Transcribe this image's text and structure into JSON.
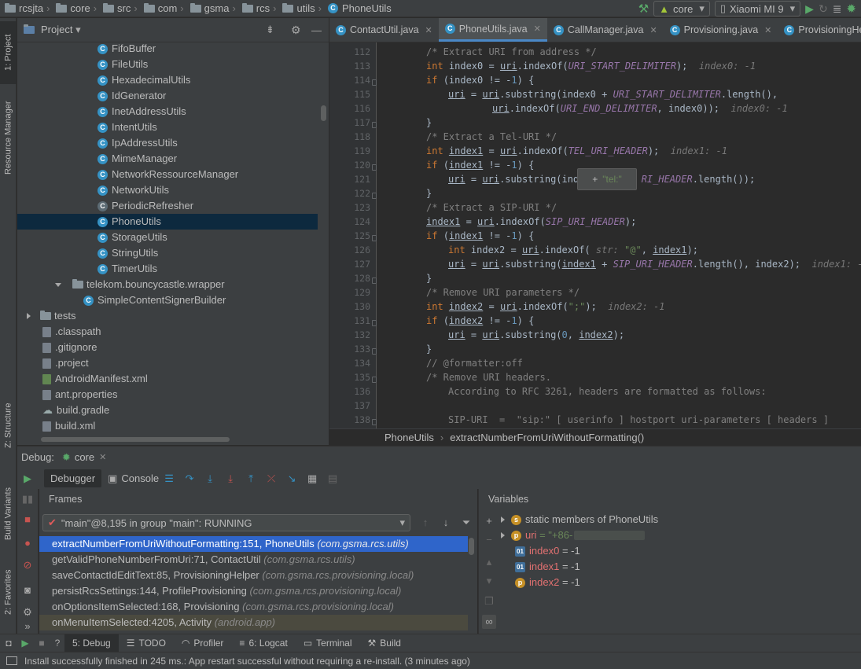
{
  "navbar": {
    "crumbs": [
      "rcsjta",
      "core",
      "src",
      "com",
      "gsma",
      "rcs",
      "utils",
      "PhoneUtils"
    ],
    "run_config": "core",
    "device": "Xiaomi MI 9"
  },
  "stripe": {
    "project": "1: Project",
    "resource_manager": "Resource Manager",
    "structure": "Z: Structure",
    "build_variants": "Build Variants",
    "favorites": "2: Favorites"
  },
  "project": {
    "title": "Project",
    "items": [
      {
        "label": "FifoBuffer",
        "kind": "class"
      },
      {
        "label": "FileUtils",
        "kind": "class"
      },
      {
        "label": "HexadecimalUtils",
        "kind": "class"
      },
      {
        "label": "IdGenerator",
        "kind": "class"
      },
      {
        "label": "InetAddressUtils",
        "kind": "class"
      },
      {
        "label": "IntentUtils",
        "kind": "class"
      },
      {
        "label": "IpAddressUtils",
        "kind": "class"
      },
      {
        "label": "MimeManager",
        "kind": "class"
      },
      {
        "label": "NetworkRessourceManager",
        "kind": "class"
      },
      {
        "label": "NetworkUtils",
        "kind": "class"
      },
      {
        "label": "PeriodicRefresher",
        "kind": "abstract"
      },
      {
        "label": "PhoneUtils",
        "kind": "class"
      },
      {
        "label": "StorageUtils",
        "kind": "class"
      },
      {
        "label": "StringUtils",
        "kind": "class"
      },
      {
        "label": "TimerUtils",
        "kind": "class"
      },
      {
        "label": "telekom.bouncycastle.wrapper",
        "kind": "package"
      },
      {
        "label": "SimpleContentSignerBuilder",
        "kind": "class"
      },
      {
        "label": "tests",
        "kind": "folder"
      },
      {
        "label": ".classpath",
        "kind": "file"
      },
      {
        "label": ".gitignore",
        "kind": "file"
      },
      {
        "label": ".project",
        "kind": "file"
      },
      {
        "label": "AndroidManifest.xml",
        "kind": "file"
      },
      {
        "label": "ant.properties",
        "kind": "file"
      },
      {
        "label": "build.gradle",
        "kind": "file"
      },
      {
        "label": "build.xml",
        "kind": "file"
      }
    ]
  },
  "tabs": [
    {
      "label": "ContactUtil.java"
    },
    {
      "label": "PhoneUtils.java"
    },
    {
      "label": "CallManager.java"
    },
    {
      "label": "Provisioning.java"
    },
    {
      "label": "ProvisioningHelper.java"
    }
  ],
  "code": {
    "line_numbers": [
      "112",
      "113",
      "114",
      "115",
      "116",
      "117",
      "118",
      "119",
      "120",
      "121",
      "122",
      "123",
      "124",
      "125",
      "126",
      "127",
      "128",
      "129",
      "130",
      "131",
      "132",
      "133",
      "134",
      "135",
      "136",
      "137",
      "138"
    ],
    "tooltip": "\"tel:\""
  },
  "editor_breadcrumb": {
    "cls": "PhoneUtils",
    "method": "extractNumberFromUriWithoutFormatting()"
  },
  "debug": {
    "label": "Debug:",
    "session": "core",
    "debugger_tab": "Debugger",
    "console_tab": "Console",
    "frames_title": "Frames",
    "variables_title": "Variables",
    "thread": "\"main\"@8,195 in group \"main\": RUNNING",
    "frames": [
      {
        "method": "extractNumberFromUriWithoutFormatting:151, PhoneUtils",
        "pkg": "(com.gsma.rcs.utils)"
      },
      {
        "method": "getValidPhoneNumberFromUri:71, ContactUtil",
        "pkg": "(com.gsma.rcs.utils)"
      },
      {
        "method": "saveContactIdEditText:85, ProvisioningHelper",
        "pkg": "(com.gsma.rcs.provisioning.local)"
      },
      {
        "method": "persistRcsSettings:144, ProfileProvisioning",
        "pkg": "(com.gsma.rcs.provisioning.local)"
      },
      {
        "method": "onOptionsItemSelected:168, Provisioning",
        "pkg": "(com.gsma.rcs.provisioning.local)"
      },
      {
        "method": "onMenuItemSelected:4205, Activity",
        "pkg": "(android.app)"
      }
    ],
    "variables": [
      {
        "name": "static",
        "value": "members of PhoneUtils"
      },
      {
        "name": "uri",
        "value": "= \"+86-"
      },
      {
        "name": "index0",
        "value": "= -1"
      },
      {
        "name": "index1",
        "value": "= -1"
      },
      {
        "name": "index2",
        "value": "= -1"
      }
    ]
  },
  "bottom_tabs": [
    {
      "label": "5: Debug"
    },
    {
      "label": "TODO"
    },
    {
      "label": "Profiler"
    },
    {
      "label": "6: Logcat"
    },
    {
      "label": "Terminal"
    },
    {
      "label": "Build"
    }
  ],
  "status": "Install successfully finished in 245 ms.: App restart successful without requiring a re-install. (3 minutes ago)"
}
